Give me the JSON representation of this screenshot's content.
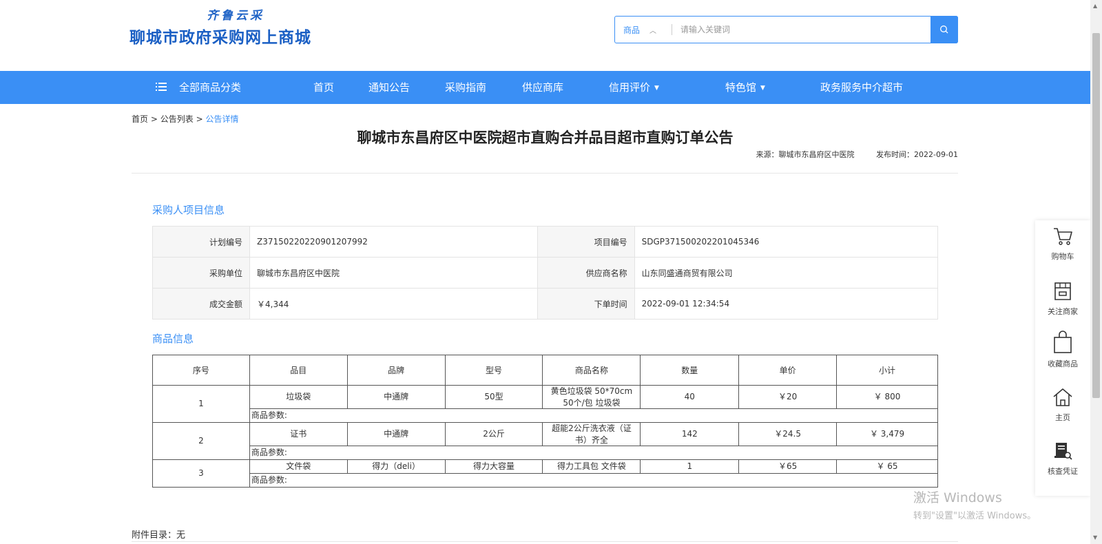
{
  "header": {
    "logo_sub": "齐鲁云采",
    "logo_main": "聊城市政府采购网上商城",
    "search_type": "商品",
    "search_placeholder": "请输入关键词"
  },
  "nav": {
    "all_categories": "全部商品分类",
    "items": [
      "首页",
      "通知公告",
      "采购指南",
      "供应商库",
      "信用评价",
      "特色馆",
      "政务服务中介超市"
    ]
  },
  "breadcrumb": {
    "home": "首页",
    "sep": ">",
    "list": "公告列表",
    "current": "公告详情"
  },
  "announcement": {
    "title": "聊城市东昌府区中医院超市直购合并品目超市直购订单公告",
    "source": "来源：聊城市东昌府区中医院",
    "publish_time": "发布时间：2022-09-01"
  },
  "buyer_section": {
    "title": "采购人项目信息",
    "rows": [
      {
        "l1": "计划编号",
        "v1": "Z37150220220901207992",
        "l2": "项目编号",
        "v2": "SDGP371500202201045346"
      },
      {
        "l1": "采购单位",
        "v1": "聊城市东昌府区中医院",
        "l2": "供应商名称",
        "v2": "山东同盛通商贸有限公司"
      },
      {
        "l1": "成交金额",
        "v1": "￥4,344",
        "l2": "下单时间",
        "v2": "2022-09-01 12:34:54"
      }
    ]
  },
  "goods_section": {
    "title": "商品信息",
    "headers": [
      "序号",
      "品目",
      "品牌",
      "型号",
      "商品名称",
      "数量",
      "单价",
      "小计"
    ],
    "param_label": "商品参数:",
    "rows": [
      {
        "no": "1",
        "category": "垃圾袋",
        "brand": "中通牌",
        "model": "50型",
        "name": "黄色垃圾袋 50*70cm 50个/包 垃圾袋",
        "qty": "40",
        "price": "￥20",
        "subtotal": "￥ 800"
      },
      {
        "no": "2",
        "category": "证书",
        "brand": "中通牌",
        "model": "2公斤",
        "name": "超能2公斤洗衣液（证书）齐全",
        "qty": "142",
        "price": "￥24.5",
        "subtotal": "￥ 3,479"
      },
      {
        "no": "3",
        "category": "文件袋",
        "brand": "得力（deli）",
        "model": "得力大容量",
        "name": "得力工具包 文件袋",
        "qty": "1",
        "price": "￥65",
        "subtotal": "￥ 65"
      }
    ]
  },
  "attachments": "附件目录：无",
  "sidebar": {
    "items": [
      {
        "label": "购物车",
        "icon": "cart-icon"
      },
      {
        "label": "关注商家",
        "icon": "store-icon"
      },
      {
        "label": "收藏商品",
        "icon": "bag-icon"
      },
      {
        "label": "主页",
        "icon": "home-icon"
      },
      {
        "label": "核查凭证",
        "icon": "verify-icon"
      }
    ]
  },
  "watermark": {
    "line1": "激活 Windows",
    "line2": "转到\"设置\"以激活 Windows。"
  },
  "colors": {
    "accent": "#3a8ff5",
    "logo": "#1a5fc4"
  }
}
